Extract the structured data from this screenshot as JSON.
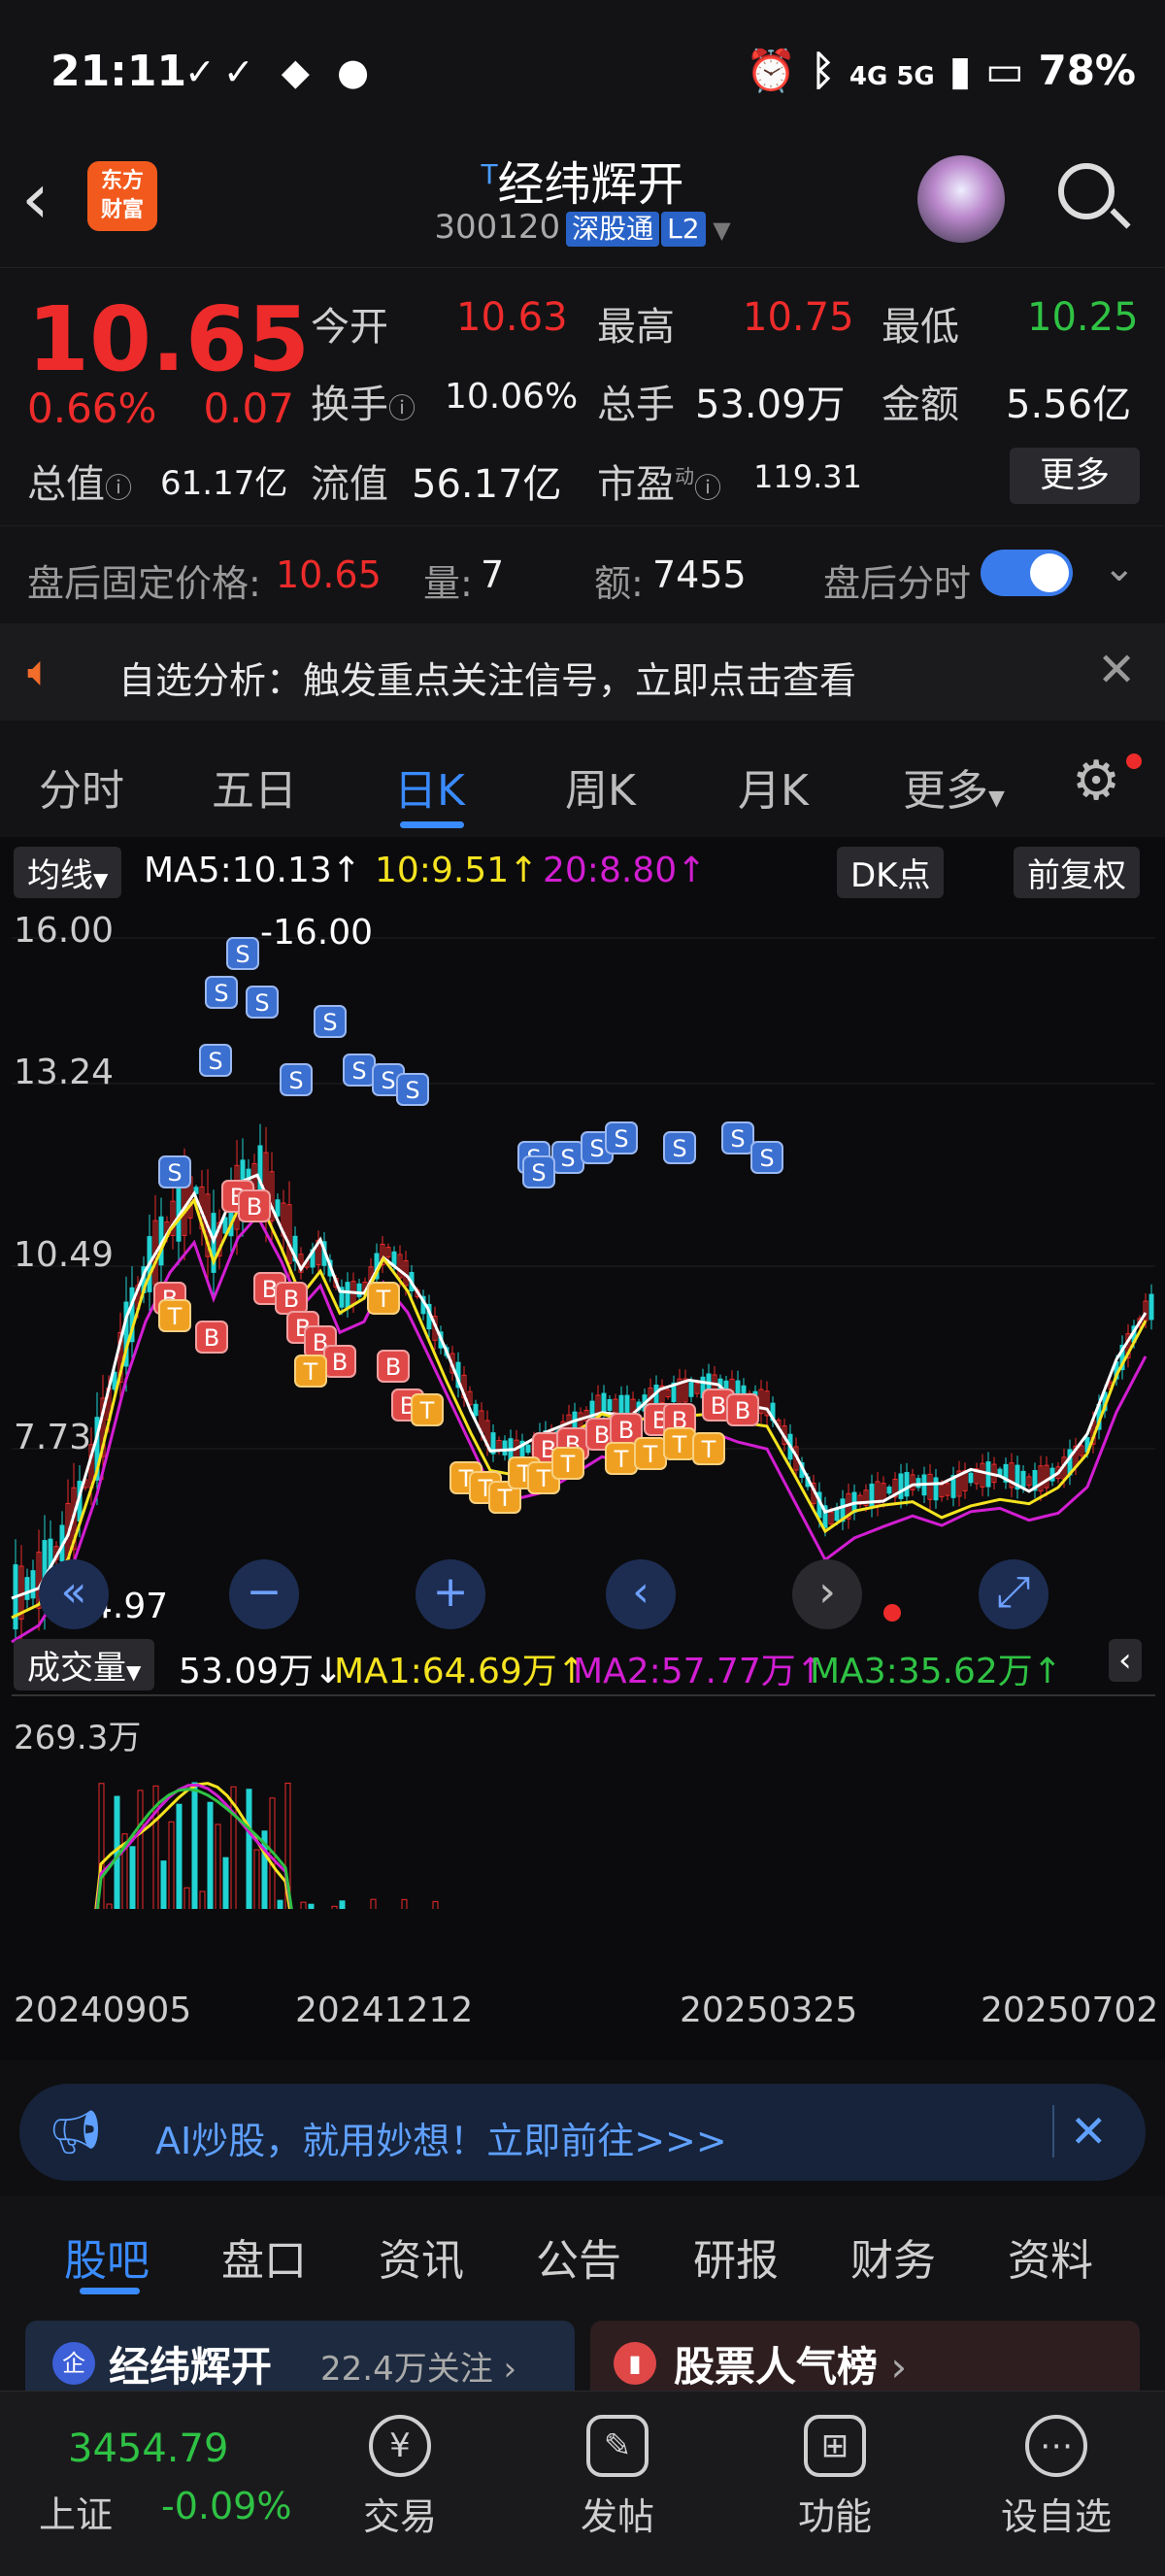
{
  "status": {
    "time": "21:11",
    "icons_left": "✓✓ ◆ ●",
    "network": "4G 5G",
    "battery": "78%"
  },
  "header": {
    "name": "经纬辉开",
    "sup": "T",
    "code": "300120",
    "tag1": "深股通",
    "tag2": "L2",
    "logo_line1": "东方",
    "logo_line2": "财富"
  },
  "quote": {
    "price": "10.65",
    "change_pct": "0.66%",
    "change_abs": "0.07",
    "open_label": "今开",
    "open": "10.63",
    "high_label": "最高",
    "high": "10.75",
    "low_label": "最低",
    "low": "10.25",
    "turnover_label": "换手",
    "turnover": "10.06%",
    "volume_label": "总手",
    "volume": "53.09万",
    "amount_label": "金额",
    "amount": "5.56亿",
    "mktcap_label": "总值",
    "mktcap": "61.17亿",
    "float_label": "流值",
    "float": "56.17亿",
    "pe_label": "市盈",
    "pe_sup": "动",
    "pe": "119.31",
    "more": "更多"
  },
  "after_hours": {
    "label": "盘后固定价格:",
    "price": "10.65",
    "vol_label": "量:",
    "vol": "7",
    "amt_label": "额:",
    "amt": "7455",
    "toggle_label": "盘后分时"
  },
  "banner": {
    "text": "自选分析：触发重点关注信号，立即点击查看"
  },
  "tabs": [
    "分时",
    "五日",
    "日K",
    "周K",
    "月K",
    "更多"
  ],
  "chart": {
    "ma_selector": "均线",
    "ma5": "MA5:10.13↑",
    "ma10": "10:9.51↑",
    "ma20": "20:8.80↑",
    "dk": "DK点",
    "adjust": "前复权",
    "y_ticks": [
      "16.00",
      "13.24",
      "10.49",
      "7.73"
    ],
    "high_note": "16.00",
    "low_note": "4.97",
    "vol_selector": "成交量",
    "vol_now": "53.09万↓",
    "vma1": "MA1:64.69万↑",
    "vma2": "MA2:57.77万↑",
    "vma3": "MA3:35.62万↑",
    "vol_top": "269.3万",
    "dates": [
      "20240905",
      "20241212",
      "20250325",
      "20250702"
    ]
  },
  "ai_banner": {
    "text": "AI炒股，就用妙想！立即前往>>>"
  },
  "subtabs": [
    "股吧",
    "盘口",
    "资讯",
    "公告",
    "研报",
    "财务",
    "资料"
  ],
  "cards": {
    "left_title": "经纬辉开",
    "left_sub": "22.4万关注",
    "right_title": "股票人气榜"
  },
  "bottom": {
    "index_value": "3454.79",
    "index_name": "上证",
    "index_change": "-0.09%",
    "items": [
      "交易",
      "发帖",
      "功能",
      "设自选"
    ]
  },
  "colors": {
    "up": "#ee2b2b",
    "down": "#2fc244",
    "accent": "#3a8bff",
    "ma5": "#ffffff",
    "ma10": "#f5e320",
    "ma20": "#d21ed2",
    "bar_down": "#22d3d3"
  }
}
